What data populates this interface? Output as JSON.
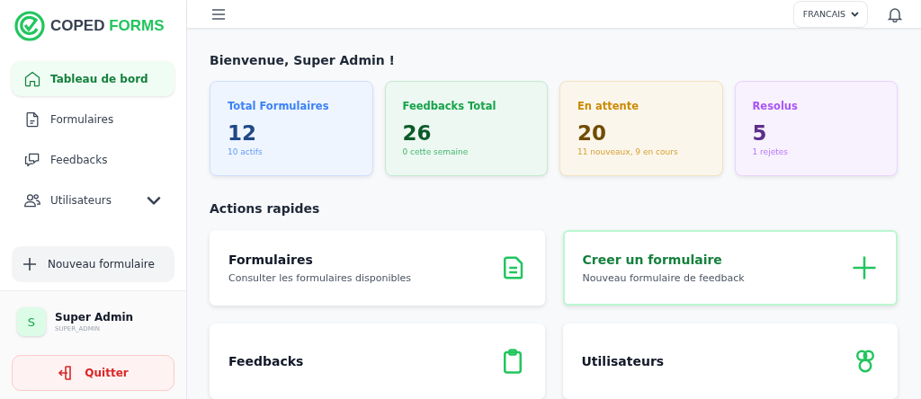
{
  "sidebar": {
    "logo": {
      "word1": "COPED",
      "word2": "FORMS"
    },
    "items": [
      {
        "label": "Tableau de bord",
        "kind": "home",
        "selected": true,
        "expandable": false
      },
      {
        "label": "Formulaires",
        "kind": "file",
        "selected": false,
        "expandable": false
      },
      {
        "label": "Feedbacks",
        "kind": "chat",
        "selected": false,
        "expandable": false
      },
      {
        "label": "Utilisateurs",
        "kind": "users",
        "selected": false,
        "expandable": true
      }
    ],
    "new_button": "Nouveau formulaire",
    "user": {
      "initial": "S",
      "name": "Super Admin",
      "role": "SUPER_ADMIN"
    },
    "logout": "Quitter"
  },
  "header": {
    "language": "FRANCAIS"
  },
  "welcome": "Bienvenue, Super Admin !",
  "stats": [
    {
      "label": "Total Formulaires",
      "value": "12",
      "detail": "10 actifs",
      "color": "#3b82f6"
    },
    {
      "label": "Feedbacks Total",
      "value": "26",
      "detail": "0 cette semaine",
      "color": "#16a34a"
    },
    {
      "label": "En attente",
      "value": "20",
      "detail": "11 nouveaux, 9 en cours",
      "color": "#ca8a04"
    },
    {
      "label": "Resolus",
      "value": "5",
      "detail": "1 rejetes",
      "color": "#a855f7"
    }
  ],
  "quick_actions_title": "Actions rapides",
  "actions": [
    {
      "kind": "file",
      "title": "Formulaires",
      "description": "Consulter les formulaires disponibles",
      "highlighted": false
    },
    {
      "kind": "plus",
      "title": "Creer un formulaire",
      "description": "Nouveau formulaire de feedback",
      "highlighted": true
    },
    {
      "kind": "clipboard",
      "title": "Feedbacks",
      "highlighted": false
    },
    {
      "kind": "users",
      "title": "Utilisateurs",
      "highlighted": false
    }
  ]
}
